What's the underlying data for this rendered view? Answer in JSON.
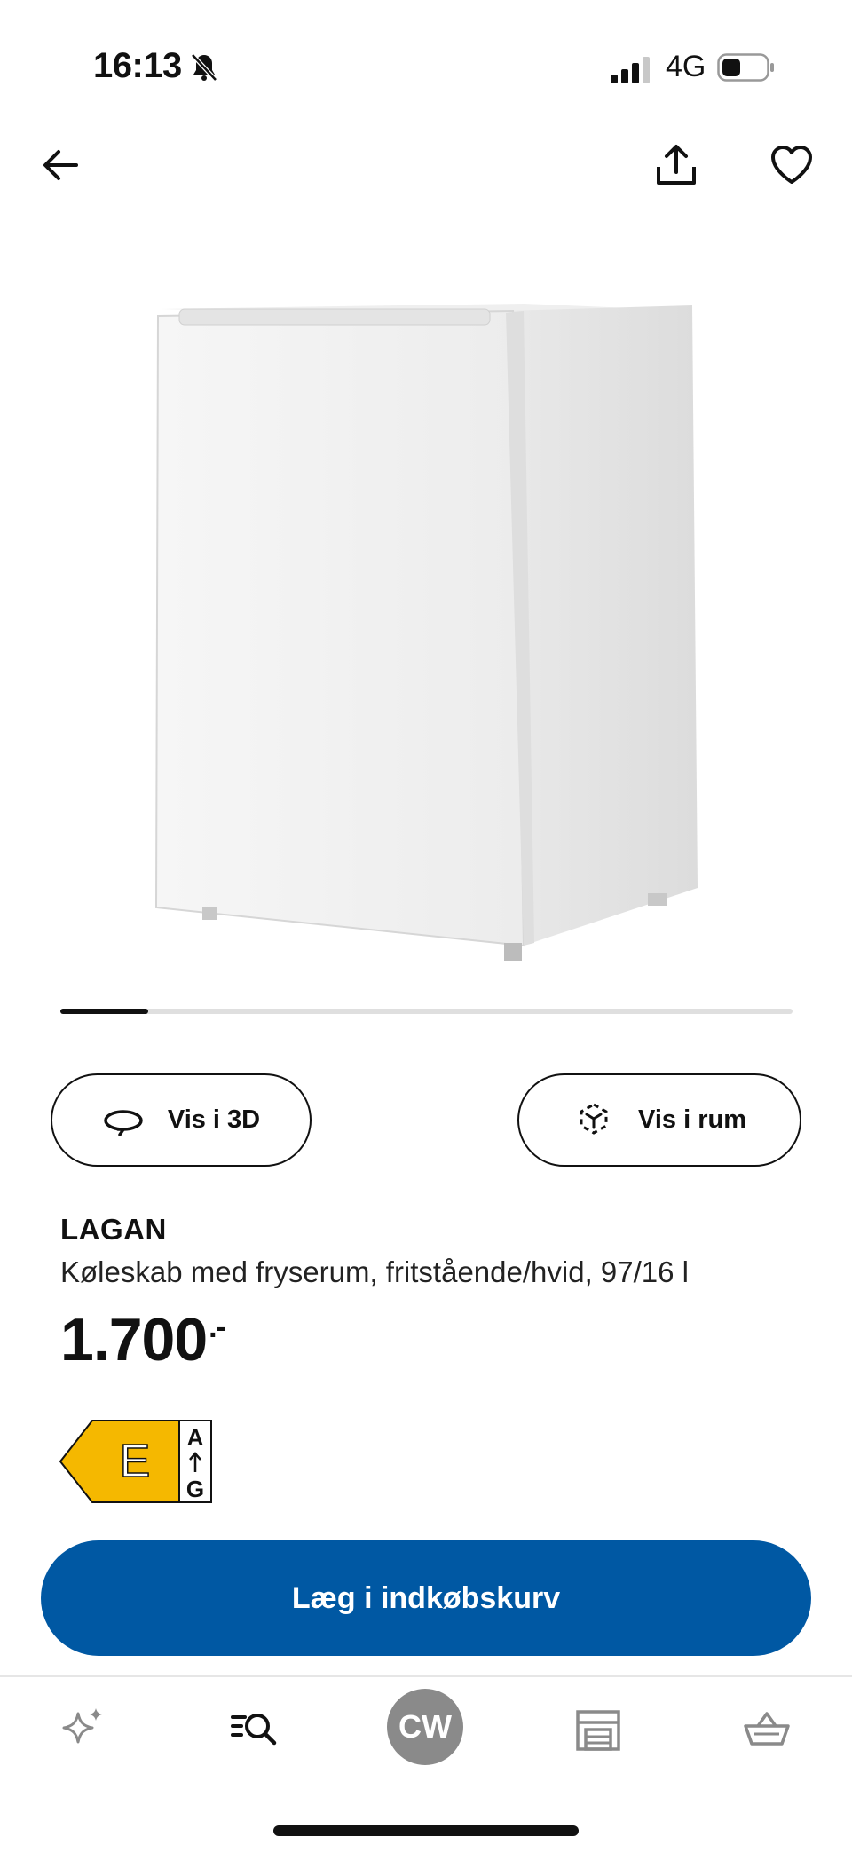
{
  "status_bar": {
    "time": "16:13",
    "network": "4G",
    "icons": [
      "bell-slash-icon",
      "signal-icon",
      "battery-icon"
    ]
  },
  "nav": {
    "icons": [
      "back-arrow-icon",
      "share-icon",
      "heart-icon"
    ]
  },
  "carousel": {
    "current_fraction": 0.12
  },
  "view_buttons": {
    "view_3d_label": "Vis i 3D",
    "view_room_label": "Vis i rum"
  },
  "product": {
    "name": "LAGAN",
    "description": "Køleskab med fryserum, fritstående/hvid, 97/16 l",
    "price": "1.700",
    "price_suffix": ".-"
  },
  "energy_label": {
    "class": "E",
    "scale_top": "A",
    "scale_bottom": "G",
    "color": "#f5b800"
  },
  "cta": {
    "label": "Læg i indkøbskurv",
    "color": "#0058a3"
  },
  "tabbar": {
    "avatar_initials": "CW",
    "icons": [
      "sparkle-icon",
      "search-list-icon",
      "avatar",
      "store-icon",
      "cart-icon"
    ]
  }
}
